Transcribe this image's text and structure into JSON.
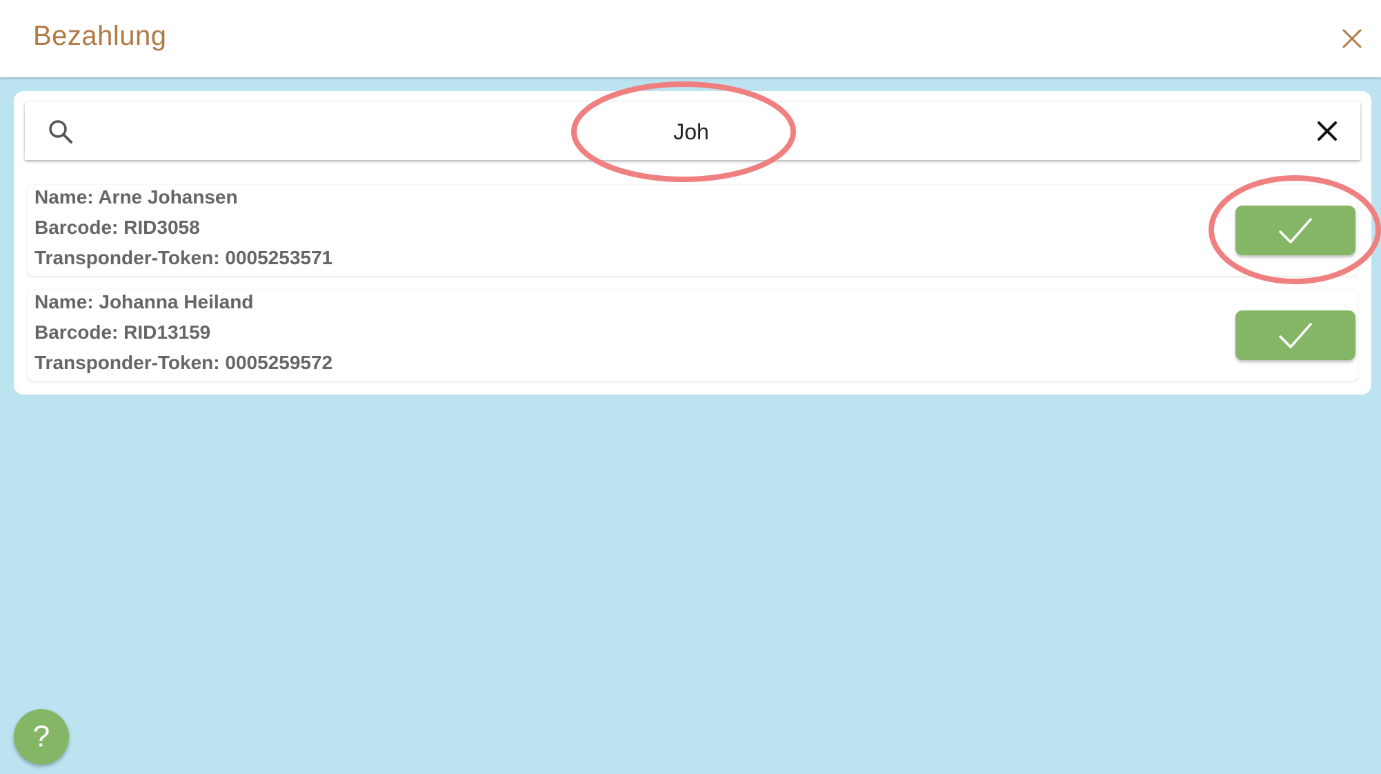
{
  "header": {
    "title": "Bezahlung"
  },
  "search": {
    "value": "Joh"
  },
  "results": [
    {
      "name": "Name: Arne Johansen",
      "barcode": "Barcode: RID3058",
      "token": "Transponder-Token: 0005253571"
    },
    {
      "name": "Name: Johanna Heiland",
      "barcode": "Barcode: RID13159",
      "token": "Transponder-Token: 0005259572"
    }
  ],
  "help": {
    "label": "?"
  },
  "icons": {
    "close": "close-icon",
    "search": "search-icon",
    "clear": "clear-icon",
    "confirm": "checkmark-icon"
  },
  "colors": {
    "background": "#bce4f0",
    "title": "#b07a44",
    "accent_green": "#85b665",
    "annotation": "#f08080"
  }
}
